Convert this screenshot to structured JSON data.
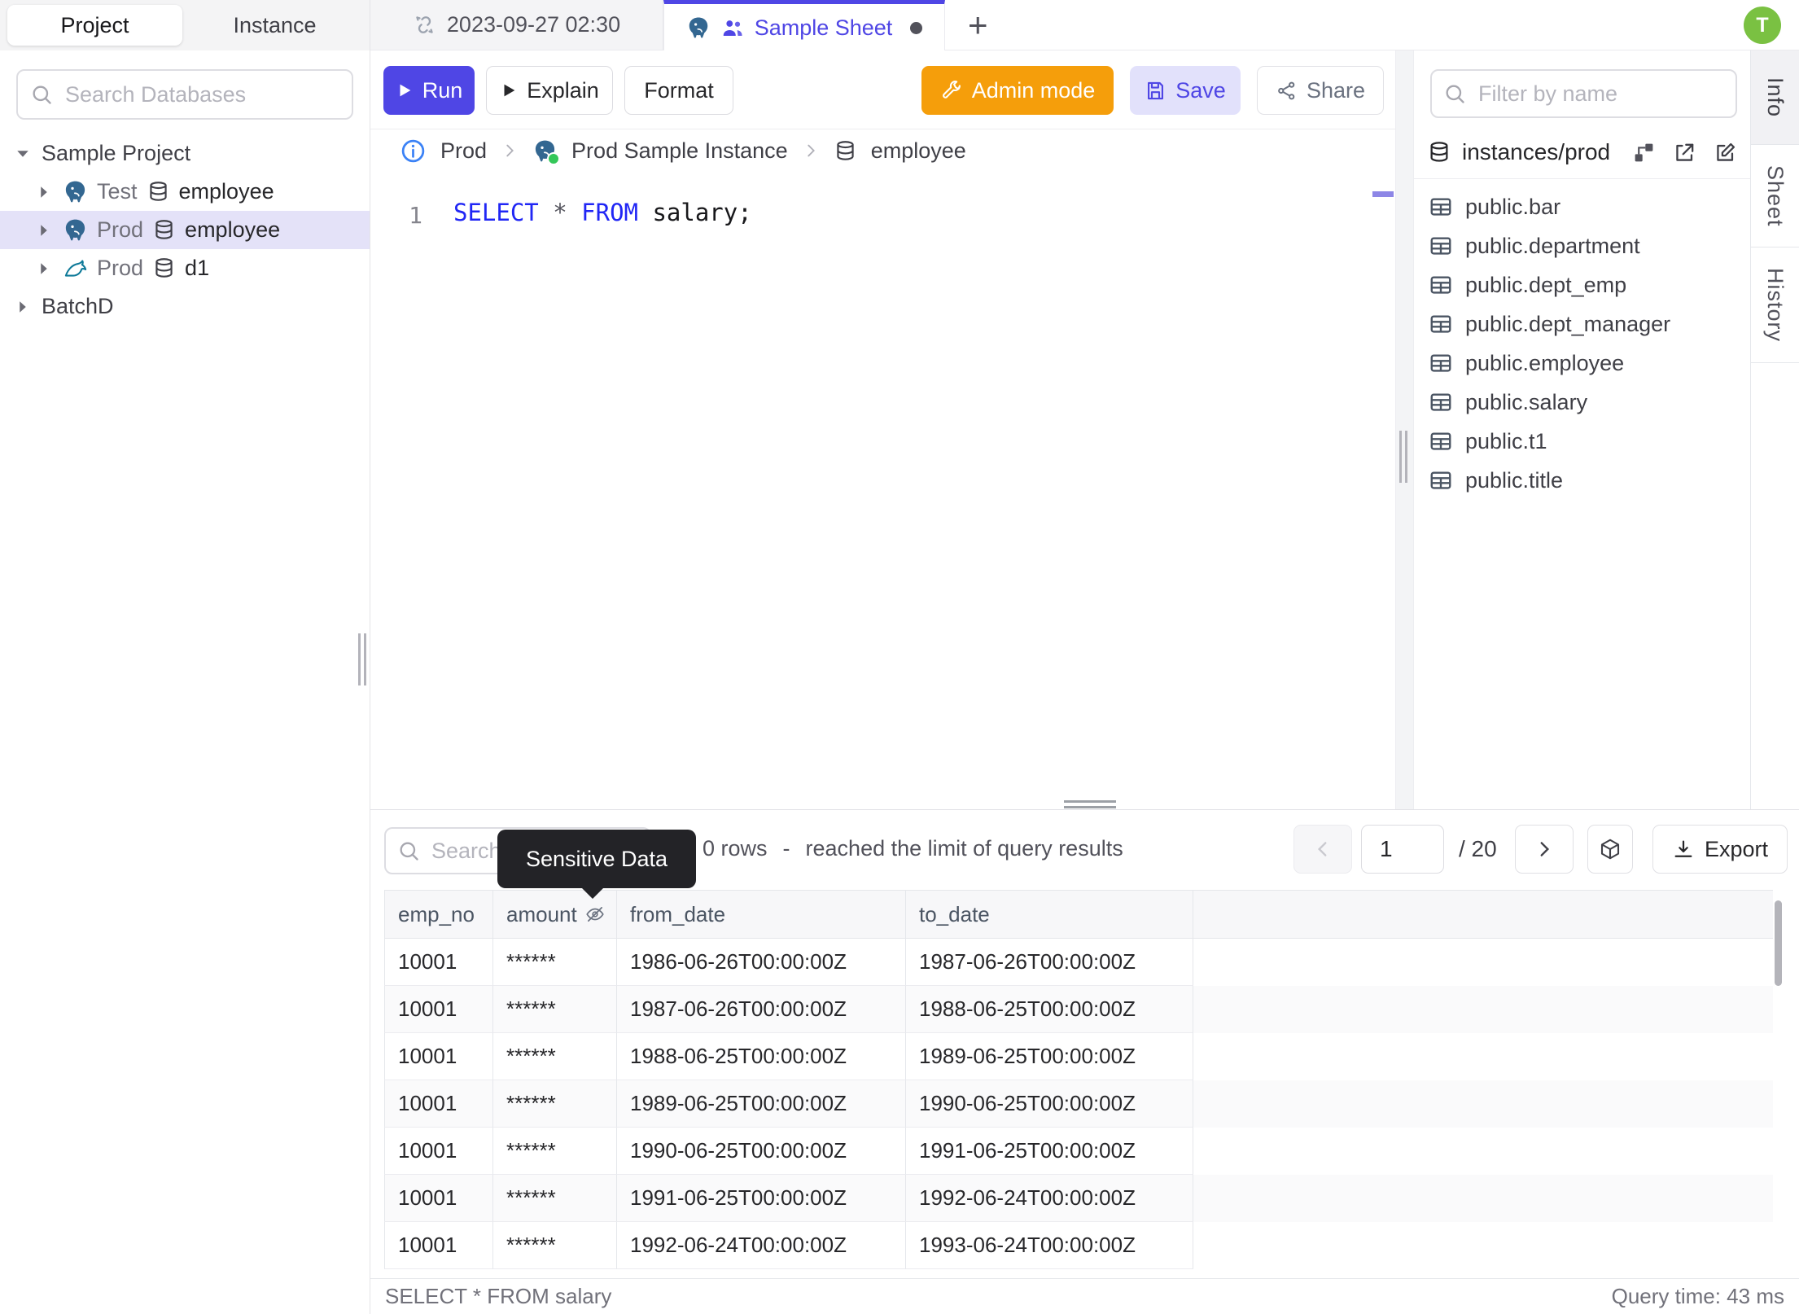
{
  "sidebar": {
    "tabs": {
      "project": "Project",
      "instance": "Instance"
    },
    "search_placeholder": "Search Databases",
    "tree": {
      "project1": "Sample Project",
      "rows": [
        {
          "env": "Test",
          "db": "employee",
          "engine": "postgres"
        },
        {
          "env": "Prod",
          "db": "employee",
          "engine": "postgres",
          "selected": true
        },
        {
          "env": "Prod",
          "db": "d1",
          "engine": "mysql"
        }
      ],
      "project2": "BatchD"
    }
  },
  "tabbar": {
    "tab1_label": "2023-09-27 02:30",
    "tab2_label": "Sample Sheet",
    "new_tab": "+",
    "avatar_initial": "T"
  },
  "toolbar": {
    "run": "Run",
    "explain": "Explain",
    "format": "Format",
    "admin_mode": "Admin mode",
    "save": "Save",
    "share": "Share"
  },
  "breadcrumb": {
    "env": "Prod",
    "instance": "Prod Sample Instance",
    "database": "employee"
  },
  "editor": {
    "line_number": "1",
    "k1": "SELECT",
    "op": " * ",
    "k2": "FROM",
    "rest": " salary;"
  },
  "right_panel": {
    "filter_placeholder": "Filter by name",
    "connection": "instances/prod",
    "tables": [
      "public.bar",
      "public.department",
      "public.dept_emp",
      "public.dept_manager",
      "public.employee",
      "public.salary",
      "public.t1",
      "public.title"
    ]
  },
  "side_tabs": {
    "info": "Info",
    "sheet": "Sheet",
    "history": "History"
  },
  "results": {
    "search_placeholder": "Search",
    "tooltip": "Sensitive Data",
    "rows_count": "0 rows",
    "dash": "-",
    "limit_note": "reached the limit of query results",
    "page": "1",
    "total": "/ 20",
    "export_label": "Export",
    "columns": [
      "emp_no",
      "amount",
      "from_date",
      "to_date"
    ],
    "rows": [
      [
        "10001",
        "******",
        "1986-06-26T00:00:00Z",
        "1987-06-26T00:00:00Z"
      ],
      [
        "10001",
        "******",
        "1987-06-26T00:00:00Z",
        "1988-06-25T00:00:00Z"
      ],
      [
        "10001",
        "******",
        "1988-06-25T00:00:00Z",
        "1989-06-25T00:00:00Z"
      ],
      [
        "10001",
        "******",
        "1989-06-25T00:00:00Z",
        "1990-06-25T00:00:00Z"
      ],
      [
        "10001",
        "******",
        "1990-06-25T00:00:00Z",
        "1991-06-25T00:00:00Z"
      ],
      [
        "10001",
        "******",
        "1991-06-25T00:00:00Z",
        "1992-06-24T00:00:00Z"
      ],
      [
        "10001",
        "******",
        "1992-06-24T00:00:00Z",
        "1993-06-24T00:00:00Z"
      ]
    ]
  },
  "statusbar": {
    "query": "SELECT * FROM salary",
    "time": "Query time: 43 ms"
  },
  "colors": {
    "accent": "#4f46e5",
    "admin_orange": "#f59e0b",
    "avatar_green": "#7ac142",
    "keyword_blue": "#2026f5",
    "selected_row": "#e4e2f8",
    "postgres_blue": "#336791",
    "mysql_teal": "#00758f",
    "status_green": "#34c759"
  },
  "icons": {
    "search": "magnifier",
    "unlink": "broken-link",
    "postgres": "elephant",
    "mysql": "dolphin",
    "database": "cylinder",
    "table": "grid",
    "people": "users",
    "run": "play",
    "admin": "wrench",
    "save": "floppy",
    "share": "nodes",
    "info": "i-circle",
    "schema": "diagram",
    "open": "external-link",
    "edit": "pencil",
    "sensitive": "eye-off",
    "prev": "chevron-left",
    "next": "chevron-right",
    "export": "download",
    "batch": "cube",
    "dirty": "dot"
  }
}
